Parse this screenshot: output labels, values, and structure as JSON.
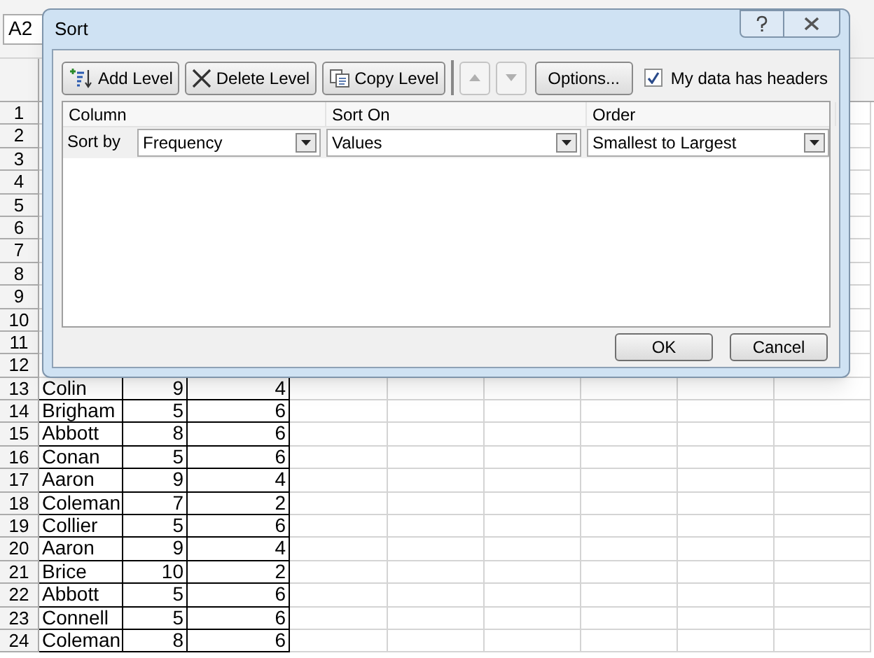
{
  "name_box": {
    "value": "A2"
  },
  "sheet": {
    "rows": [
      {
        "number": "1",
        "cells": []
      },
      {
        "number": "2",
        "cells": []
      },
      {
        "number": "3",
        "cells": []
      },
      {
        "number": "4",
        "cells": []
      },
      {
        "number": "5",
        "cells": []
      },
      {
        "number": "6",
        "cells": []
      },
      {
        "number": "7",
        "cells": []
      },
      {
        "number": "8",
        "cells": []
      },
      {
        "number": "9",
        "cells": []
      },
      {
        "number": "10",
        "cells": []
      },
      {
        "number": "11",
        "cells": []
      },
      {
        "number": "12",
        "cells": []
      },
      {
        "number": "13",
        "cells": [
          "Colin",
          "9",
          "4"
        ]
      },
      {
        "number": "14",
        "cells": [
          "Brigham",
          "5",
          "6"
        ]
      },
      {
        "number": "15",
        "cells": [
          "Abbott",
          "8",
          "6"
        ]
      },
      {
        "number": "16",
        "cells": [
          "Conan",
          "5",
          "6"
        ]
      },
      {
        "number": "17",
        "cells": [
          "Aaron",
          "9",
          "4"
        ]
      },
      {
        "number": "18",
        "cells": [
          "Coleman",
          "7",
          "2"
        ]
      },
      {
        "number": "19",
        "cells": [
          "Collier",
          "5",
          "6"
        ]
      },
      {
        "number": "20",
        "cells": [
          "Aaron",
          "9",
          "4"
        ]
      },
      {
        "number": "21",
        "cells": [
          "Brice",
          "10",
          "2"
        ]
      },
      {
        "number": "22",
        "cells": [
          "Abbott",
          "5",
          "6"
        ]
      },
      {
        "number": "23",
        "cells": [
          "Connell",
          "5",
          "6"
        ]
      },
      {
        "number": "24",
        "cells": [
          "Coleman",
          "8",
          "6"
        ]
      }
    ]
  },
  "dialog": {
    "title": "Sort",
    "toolbar": [
      {
        "kind": "add",
        "label": "Add Level"
      },
      {
        "kind": "delete",
        "label": "Delete Level"
      },
      {
        "kind": "copy",
        "label": "Copy Level"
      }
    ],
    "move_buttons": [
      {
        "kind": "up",
        "disabled": true
      },
      {
        "kind": "down",
        "disabled": true
      }
    ],
    "options_button": "Options...",
    "headers_checkbox": {
      "label": "My data has headers",
      "checked": true
    },
    "columns": [
      "Column",
      "Sort On",
      "Order"
    ],
    "levels": [
      {
        "label": "Sort by",
        "column": "Frequency",
        "sort_on": "Values",
        "order": "Smallest to Largest"
      }
    ],
    "buttons": [
      "OK",
      "Cancel"
    ]
  }
}
